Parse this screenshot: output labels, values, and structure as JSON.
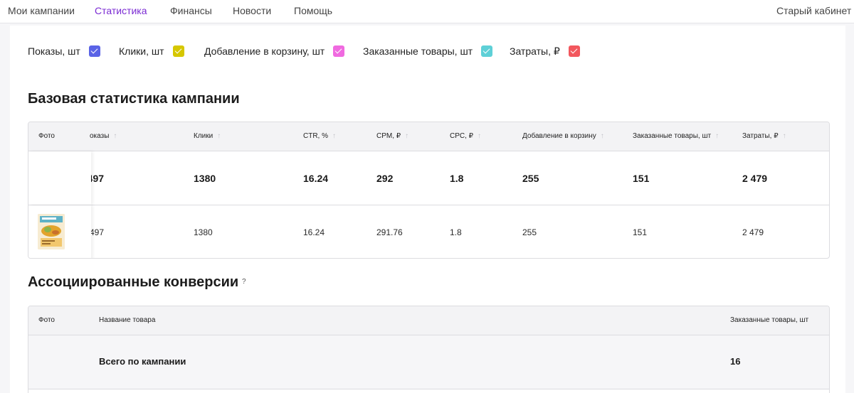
{
  "nav": {
    "items": [
      "Мои кампании",
      "Статистика",
      "Финансы",
      "Новости",
      "Помощь"
    ],
    "active": "Статистика",
    "right_link": "Старый кабинет"
  },
  "filters": [
    {
      "label": "Показы, шт",
      "color": "#5a63e6",
      "checked": true
    },
    {
      "label": "Клики, шт",
      "color": "#d6c700",
      "checked": true
    },
    {
      "label": "Добавление в корзину, шт",
      "color": "#f06ae0",
      "checked": true
    },
    {
      "label": "Заказанные товары, шт",
      "color": "#5ed0d7",
      "checked": true
    },
    {
      "label": "Затраты, ₽",
      "color": "#f2575d",
      "checked": true
    }
  ],
  "basic_stats": {
    "title": "Базовая статистика кампании",
    "columns": [
      "Фото",
      "оказы",
      "Клики",
      "CTR, %",
      "CPM, ₽",
      "CPC, ₽",
      "Добавление в корзину",
      "Заказанные товары, шт",
      "Затраты, ₽"
    ],
    "sort_icon": "sort-arrow-up-icon",
    "total_row": [
      "",
      ";497",
      "1380",
      "16.24",
      "292",
      "1.8",
      "255",
      "151",
      "2 479"
    ],
    "product_row": [
      "",
      "497",
      "1380",
      "16.24",
      "291.76",
      "1.8",
      "255",
      "151",
      "2 479"
    ]
  },
  "assoc": {
    "title": "Ассоциированные конверсии",
    "help": "?",
    "columns": [
      "Фото",
      "Название товара",
      "Заказанные товары, шт"
    ],
    "total_label": "Всего по кампании",
    "total_value": "16"
  }
}
